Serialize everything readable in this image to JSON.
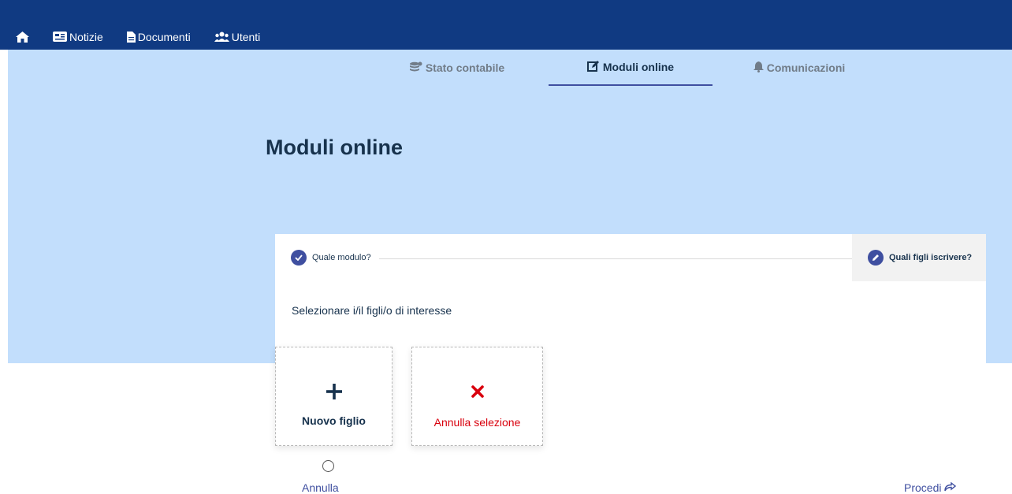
{
  "topnav": {
    "home_icon": "home-icon",
    "items": [
      {
        "label": "Notizie",
        "icon": "newspaper-icon"
      },
      {
        "label": "Documenti",
        "icon": "document-icon"
      },
      {
        "label": "Utenti",
        "icon": "users-icon"
      }
    ]
  },
  "tabs": [
    {
      "label": "Stato contabile",
      "icon": "coins-icon",
      "active": false
    },
    {
      "label": "Moduli online",
      "icon": "edit-icon",
      "active": true
    },
    {
      "label": "Comunicazioni",
      "icon": "bell-icon",
      "active": false
    }
  ],
  "page": {
    "title": "Moduli online"
  },
  "stepper": {
    "step1": {
      "label": "Quale modulo?",
      "icon": "check-icon"
    },
    "step2": {
      "label": "Quali figli iscrivere?",
      "icon": "pencil-icon"
    }
  },
  "form": {
    "instruction": "Selezionare i/il figli/o di interesse",
    "new_child": {
      "label": "Nuovo figlio",
      "icon": "plus-icon"
    },
    "cancel_selection": {
      "label": "Annulla selezione",
      "icon": "x-icon"
    }
  },
  "actions": {
    "cancel_label": "Annulla",
    "proceed_label": "Procedi",
    "proceed_icon": "share-icon"
  },
  "colors": {
    "topbar": "#103a82",
    "hero": "#c2defc",
    "accent": "#3f4fa0",
    "title": "#17324d",
    "danger": "#d9000d"
  }
}
